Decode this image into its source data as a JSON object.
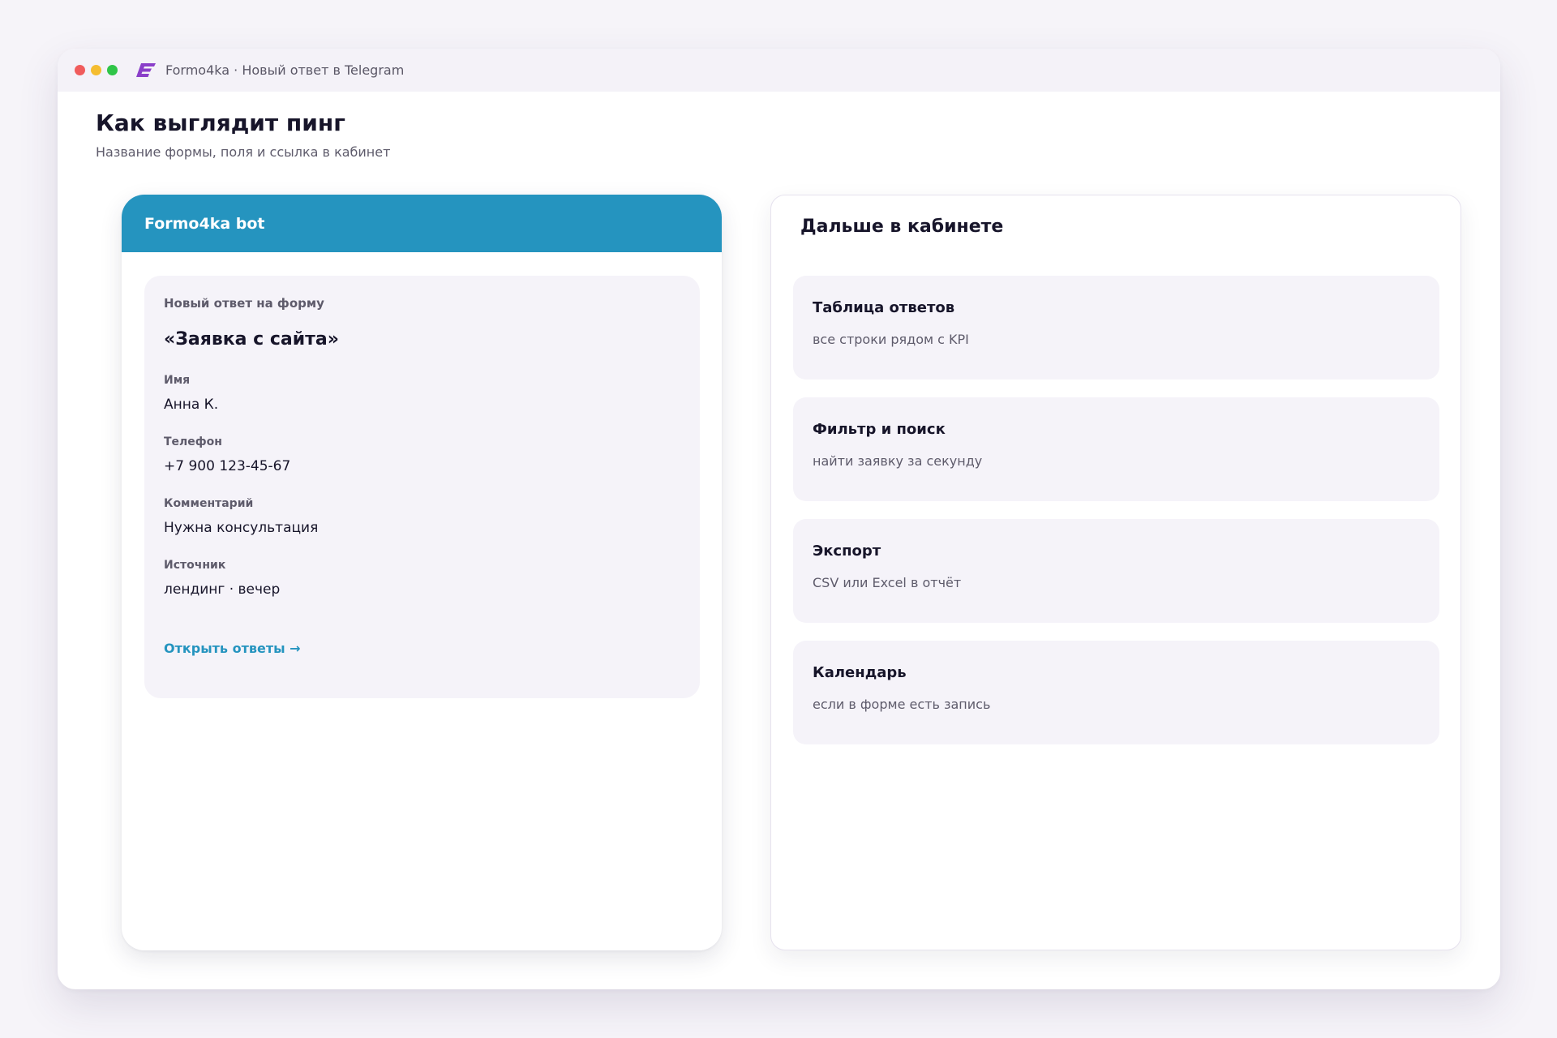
{
  "window": {
    "title": "Formo4ka · Новый ответ в Telegram",
    "logo_icon": "formo4ka-logo-icon",
    "logo_color": "#8a3fc9"
  },
  "page": {
    "title": "Как выглядит пинг",
    "subtitle": "Название формы, поля и ссылка в кабинет"
  },
  "telegram": {
    "bot_name": "Formo4ka bot",
    "header_color": "#2594bf",
    "message": {
      "kicker": "Новый ответ на форму",
      "form_name": "«Заявка с сайта»",
      "fields": [
        {
          "label": "Имя",
          "value": "Анна К."
        },
        {
          "label": "Телефон",
          "value": "+7 900 123-45-67"
        },
        {
          "label": "Комментарий",
          "value": "Нужна консультация"
        },
        {
          "label": "Источник",
          "value": "лендинг · вечер"
        }
      ],
      "link_label": "Открыть ответы →"
    }
  },
  "next": {
    "title": "Дальше в кабинете",
    "features": [
      {
        "title": "Таблица ответов",
        "description": "все строки рядом с KPI"
      },
      {
        "title": "Фильтр и поиск",
        "description": "найти заявку за секунду"
      },
      {
        "title": "Экспорт",
        "description": "CSV или Excel в отчёт"
      },
      {
        "title": "Календарь",
        "description": "если в форме есть запись"
      }
    ]
  }
}
